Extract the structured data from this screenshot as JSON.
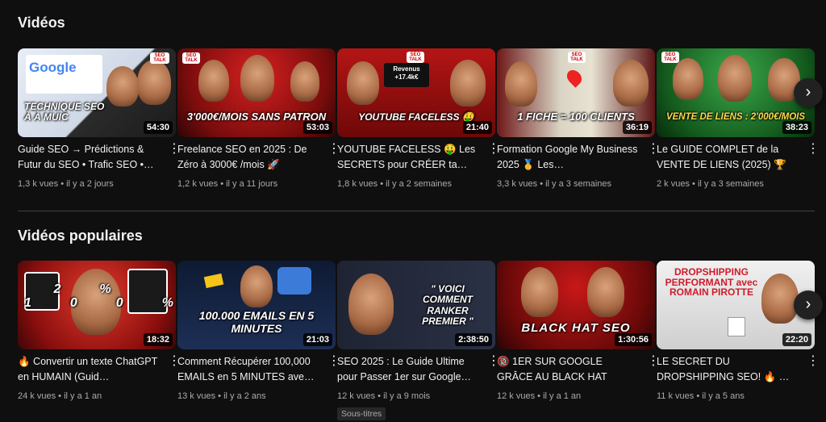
{
  "sections": [
    {
      "title": "Vidéos",
      "videos": [
        {
          "title": "Guide SEO → Prédictions & Futur du SEO • Trafic SEO •…",
          "views": "1,3 k vues",
          "age": "il y a 2 jours",
          "duration": "54:30",
          "thumb_text": "TECHNIQUE SEO À À MUIC",
          "thumb_color": "#3a3a3a",
          "logo_text": "Google"
        },
        {
          "title": "Freelance SEO en 2025 : De Zéro à 3000€ /mois 🚀",
          "views": "1,2 k vues",
          "age": "il y a 11 jours",
          "duration": "53:03",
          "thumb_text": "3'000€/MOIS SANS PATRON",
          "thumb_color": "#8a1010"
        },
        {
          "title": "YOUTUBE FACELESS 🤑 Les SECRETS pour CRÉER ta…",
          "views": "1,8 k vues",
          "age": "il y a 2 semaines",
          "duration": "21:40",
          "thumb_text": "YOUTUBE FACELESS 🤑",
          "thumb_color": "#9b1111",
          "extra_text": "Revenus +17.4k€"
        },
        {
          "title": "Formation Google My Business 2025 🥇 Les…",
          "views": "3,3 k vues",
          "age": "il y a 3 semaines",
          "duration": "36:19",
          "thumb_text": "1 FICHE = 100 CLIENTS",
          "thumb_color": "#7a1a1a"
        },
        {
          "title": "Le GUIDE COMPLET de la VENTE DE LIENS (2025) 🏆",
          "views": "2 k vues",
          "age": "il y a 3 semaines",
          "duration": "38:23",
          "thumb_text": "VENTE DE LIENS : 2'000€/MOIS",
          "thumb_color": "#15521c"
        }
      ]
    },
    {
      "title": "Vidéos populaires",
      "videos": [
        {
          "title": "🔥 Convertir un texte ChatGPT en HUMAIN (Guid…",
          "views": "24 k vues",
          "age": "il y a 1 an",
          "duration": "18:32",
          "thumb_text": "2% 100%",
          "thumb_color": "#a11616"
        },
        {
          "title": "Comment Récupérer 100,000 EMAILS en 5 MINUTES ave…",
          "views": "13 k vues",
          "age": "il y a 2 ans",
          "duration": "21:03",
          "thumb_text": "100.000 EMAILS EN 5 MINUTES",
          "thumb_color": "#1b2a4a"
        },
        {
          "title": "SEO 2025 : Le Guide Ultime pour Passer 1er sur Google…",
          "views": "12 k vues",
          "age": "il y a 9 mois",
          "duration": "2:38:50",
          "thumb_text": "\" VOICI COMMENT RANKER PREMIER \"",
          "thumb_color": "#232a3a",
          "chip": "Sous-titres"
        },
        {
          "title": "🔞 1ER SUR GOOGLE GRÂCE AU BLACK HAT SEO…",
          "views": "12 k vues",
          "age": "il y a 1 an",
          "duration": "1:30:56",
          "thumb_text": "BLACK HAT SEO",
          "thumb_color": "#8a0f0f"
        },
        {
          "title": "LE SECRET DU DROPSHIPPING SEO! 🔥 …",
          "views": "11 k vues",
          "age": "il y a 5 ans",
          "duration": "22:20",
          "thumb_text": "DROPSHIPPING PERFORMANT avec ROMAIN PIROTTE",
          "thumb_color": "#d9d9d9"
        }
      ]
    }
  ],
  "more_icon": "⋮",
  "next_icon": "›",
  "badge_text": "SEO TALK"
}
